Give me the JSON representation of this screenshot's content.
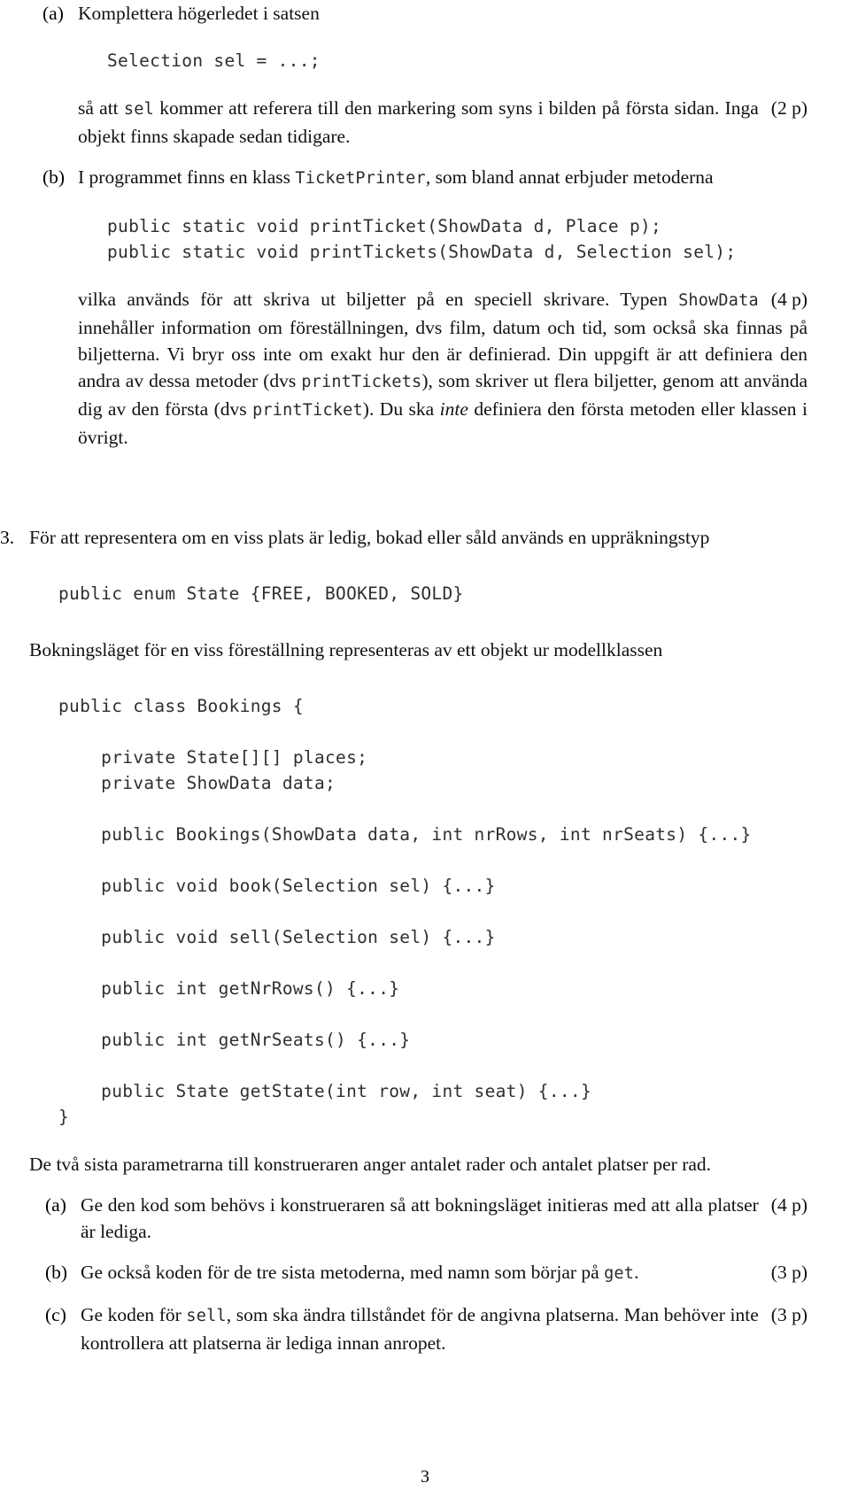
{
  "document": {
    "page_number": "3",
    "language": "sv"
  },
  "exercise2": {
    "items": [
      {
        "label": "(a)",
        "lead": "Komplettera högerledet i satsen",
        "code": "Selection sel = ...;",
        "body_pre": "så att ",
        "body_tt": "sel",
        "body_post": " kommer att referera till den markering som syns i bilden på första sidan. Inga objekt finns skapade sedan tidigare.",
        "points": "(2 p)"
      },
      {
        "label": "(b)",
        "lead_pre": "I programmet finns en klass ",
        "lead_tt": "TicketPrinter",
        "lead_post": ", som bland annat erbjuder metoderna",
        "code_line1": "public static void printTicket(ShowData d, Place p);",
        "code_line2": "public static void printTickets(ShowData d, Selection sel);",
        "body_1": "vilka används för att skriva ut biljetter på en speciell skrivare. Typen ",
        "body_tt_1": "ShowData",
        "body_2": " innehåller information om föreställningen, dvs film, datum och tid, som också ska finnas på biljetterna. Vi bryr oss inte om exakt hur den är definierad. Din uppgift är att definiera den andra av dessa metoder (dvs ",
        "body_tt_2": "printTickets",
        "body_3": "), som skriver ut flera biljetter, genom att använda dig av den första (dvs ",
        "body_tt_3": "printTicket",
        "body_4": "). Du ska ",
        "body_em": "inte",
        "body_5": " definiera den första metoden eller klassen i övrigt.",
        "points": "(4 p)"
      }
    ]
  },
  "exercise3": {
    "number": "3.",
    "lead": "För att representera om en viss plats är ledig, bokad eller såld används en uppräkningstyp",
    "enum_code": "public enum State {FREE, BOOKED, SOLD}",
    "mid_text": "Bokningsläget för en viss föreställning representeras av ett objekt ur modellklassen",
    "class_code": "public class Bookings {\n\n    private State[][] places;\n    private ShowData data;\n\n    public Bookings(ShowData data, int nrRows, int nrSeats) {...}\n\n    public void book(Selection sel) {...}\n\n    public void sell(Selection sel) {...}\n\n    public int getNrRows() {...}\n\n    public int getNrSeats() {...}\n\n    public State getState(int row, int seat) {...}\n}",
    "after_text": "De två sista parametrarna till konstrueraren anger antalet rader och antalet platser per rad.",
    "items": [
      {
        "label": "(a)",
        "text": "Ge den kod som behövs i konstrueraren så att bokningsläget initieras med att alla platser är lediga.",
        "points": "(4 p)"
      },
      {
        "label": "(b)",
        "text_pre": "Ge också koden för de tre sista metoderna, med namn som börjar på ",
        "text_tt": "get",
        "text_post": ".",
        "points": "(3 p)"
      },
      {
        "label": "(c)",
        "text_pre": "Ge koden för ",
        "text_tt": "sell",
        "text_post": ", som ska ändra tillståndet för de angivna platserna. Man behöver inte kontrollera att platserna är lediga innan anropet.",
        "points": "(3 p)"
      }
    ]
  }
}
